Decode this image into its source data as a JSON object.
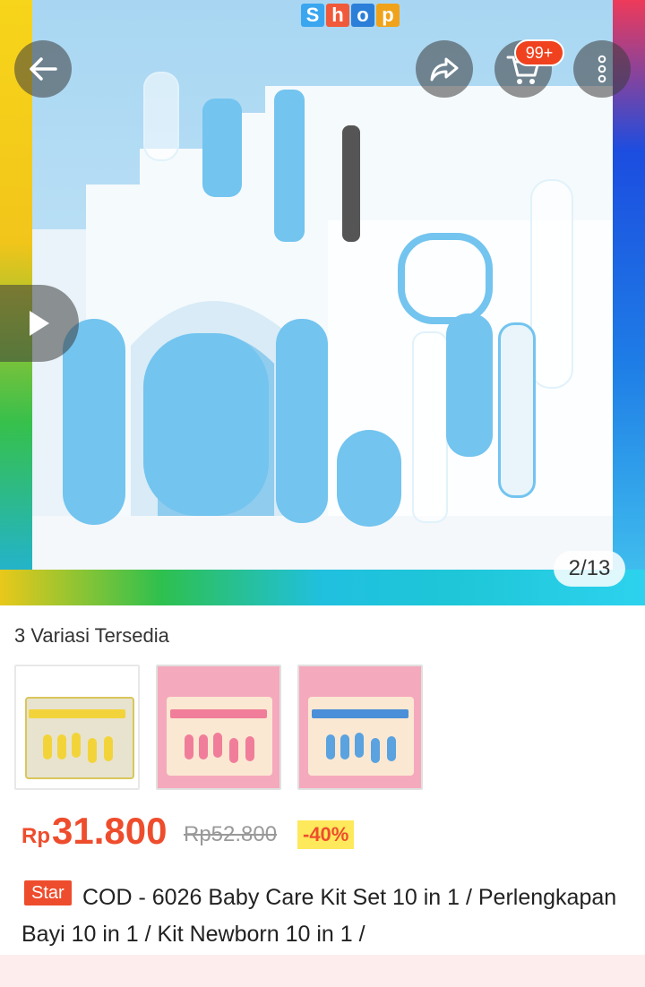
{
  "header": {
    "back_icon": "arrow-left-icon",
    "share_icon": "share-icon",
    "cart_icon": "cart-icon",
    "cart_badge": "99+",
    "more_icon": "more-vertical-icon"
  },
  "gallery": {
    "counter": "2/13",
    "play_icon": "play-icon",
    "logo_letters": [
      "S",
      "h",
      "o",
      "p"
    ]
  },
  "variations": {
    "title": "3 Variasi Tersedia"
  },
  "price": {
    "currency": "Rp",
    "current": "31.800",
    "original": "Rp52.800",
    "discount": "-40%"
  },
  "product": {
    "badge": "Star",
    "title": "COD - 6026 Baby Care Kit Set 10 in 1 / Perlengkapan Bayi 10 in 1 / Kit Newborn 10 in 1 /"
  },
  "colors": {
    "accent": "#ee4d2d",
    "discount_bg": "#fde95b",
    "item_blue": "#73c4ef"
  }
}
